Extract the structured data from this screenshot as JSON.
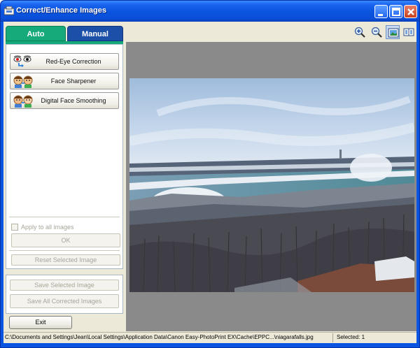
{
  "window": {
    "title": "Correct/Enhance Images"
  },
  "tabs": [
    {
      "label": "Auto"
    },
    {
      "label": "Manual"
    }
  ],
  "corrections": [
    {
      "label": "Red-Eye Correction",
      "icon": "red-eye-icon"
    },
    {
      "label": "Face Sharpener",
      "icon": "face-sharpener-icon"
    },
    {
      "label": "Digital Face Smoothing",
      "icon": "face-smoothing-icon"
    }
  ],
  "options": {
    "apply_all_label": "Apply to all images",
    "apply_all_checked": false,
    "ok_label": "OK",
    "reset_label": "Reset Selected Image"
  },
  "save": {
    "save_selected_label": "Save Selected Image",
    "save_all_label": "Save All Corrected Images"
  },
  "exit_label": "Exit",
  "toolbar": {
    "icons": [
      "zoom-in-icon",
      "zoom-out-icon",
      "whole-image-icon",
      "compare-icon"
    ]
  },
  "status": {
    "path": "C:\\Documents and Settings\\Jean\\Local Settings\\Application Data\\Canon Easy-PhotoPrint EX\\Cache\\EPPC...\\niagarafalls.jpg",
    "selected": "Selected: 1"
  },
  "colors": {
    "auto_tab": "#16a97a",
    "manual_tab": "#1c4fa8",
    "titlebar": "#0a55e0",
    "preview_background": "#8a8a8a"
  }
}
